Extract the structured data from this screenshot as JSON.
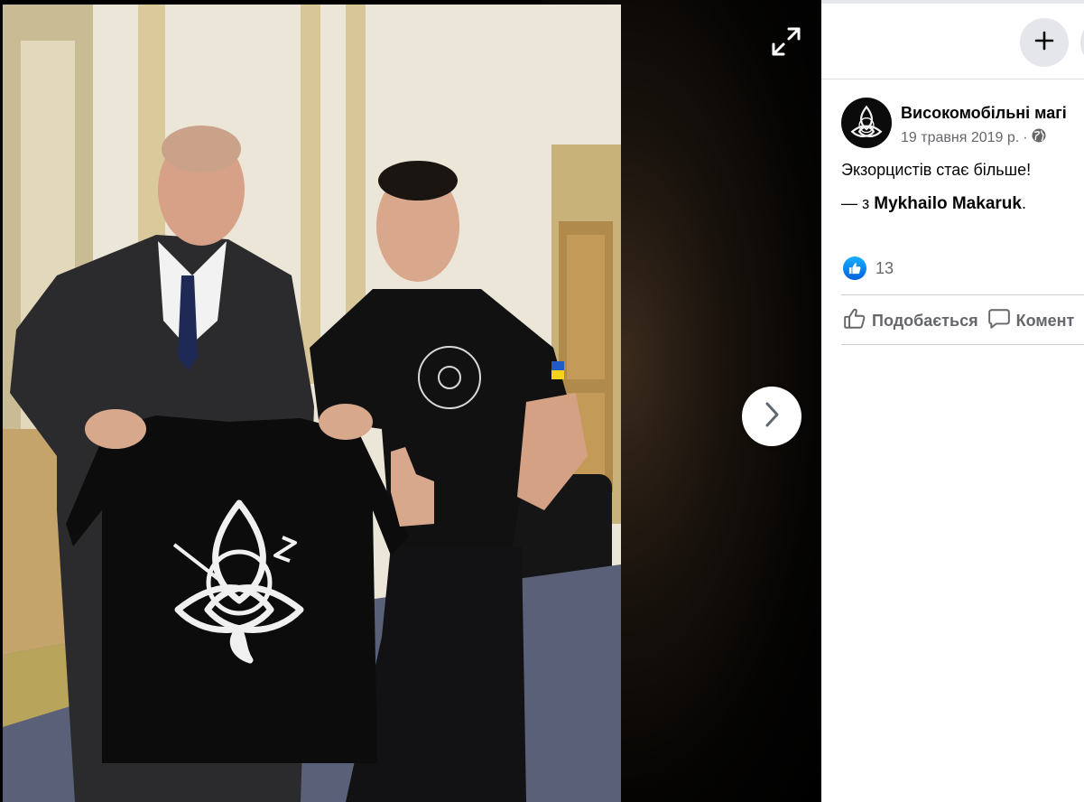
{
  "post": {
    "page_name": "Високомобільні магі",
    "date": "19 травня 2019 р.",
    "separator": "·",
    "visibility_icon": "globe-icon",
    "text": "Экзорцистів стає більше!",
    "with_prefix": "— з",
    "with_name": "Mykhailo Makaruk",
    "with_suffix": ".",
    "reaction_icon": "like-reaction-icon",
    "reaction_count": "13"
  },
  "actions": {
    "like_label": "Подобається",
    "comment_label": "Комент"
  },
  "viewer": {
    "expand_icon": "expand-icon",
    "next_icon": "chevron-right-icon",
    "photo_alt": "photo"
  },
  "header": {
    "create_icon": "plus-icon"
  },
  "colors": {
    "accent_blue": "#0866ff",
    "secondary_text": "#65676b",
    "button_bg": "#e4e6eb"
  }
}
